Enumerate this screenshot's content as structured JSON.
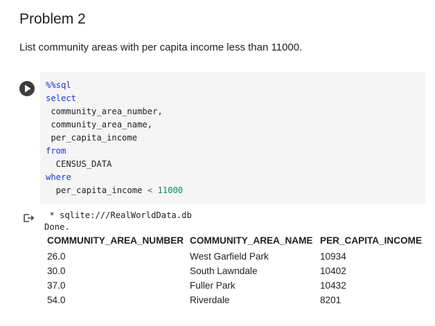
{
  "problem": {
    "title": "Problem 2",
    "description": "List community areas with per capita income less than 11000."
  },
  "code_cell": {
    "run_icon": "play-icon",
    "lines": {
      "magic": "%%sql",
      "select_kw": "select",
      "col1": " community_area_number,",
      "col2": " community_area_name,",
      "col3": " per_capita_income",
      "from_kw": "from",
      "table": "  CENSUS_DATA",
      "where_kw": "where",
      "cond_lhs": "  per_capita_income ",
      "cond_op": "<",
      "cond_val": "11000"
    }
  },
  "output": {
    "icon": "output-arrow-icon",
    "connection": " * sqlite:///RealWorldData.db",
    "status": "Done.",
    "table": {
      "headers": [
        "COMMUNITY_AREA_NUMBER",
        "COMMUNITY_AREA_NAME",
        "PER_CAPITA_INCOME"
      ],
      "rows": [
        [
          "26.0",
          "West Garfield Park",
          "10934"
        ],
        [
          "30.0",
          "South Lawndale",
          "10402"
        ],
        [
          "37.0",
          "Fuller Park",
          "10432"
        ],
        [
          "54.0",
          "Riverdale",
          "8201"
        ]
      ]
    }
  },
  "colors": {
    "keyword": "#1a36d8",
    "number": "#0a8a5a",
    "code_bg": "#f5f5f5"
  }
}
